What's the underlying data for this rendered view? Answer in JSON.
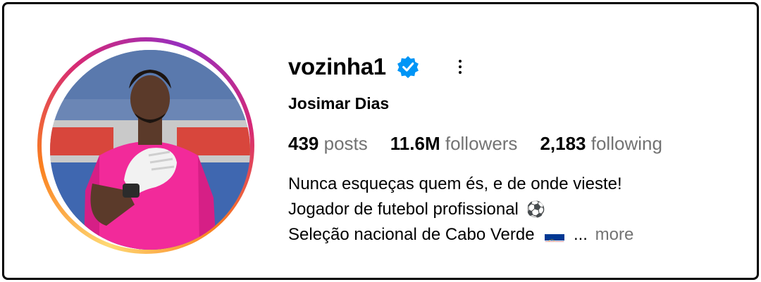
{
  "profile": {
    "username": "vozinha1",
    "verified": true,
    "full_name": "Josimar Dias"
  },
  "stats": [
    {
      "value": "439",
      "label": "posts"
    },
    {
      "value": "11.6M",
      "label": "followers"
    },
    {
      "value": "2,183",
      "label": "following"
    }
  ],
  "bio": {
    "line1": "Nunca esqueças quem és, e de onde vieste!",
    "line2": "Jogador de futebol profissional",
    "line2_emoji": "⚽",
    "line3": "Seleção nacional de Cabo Verde",
    "ellipsis": "...",
    "more_label": "more"
  },
  "colors": {
    "verified_blue": "#0095f6",
    "secondary_text": "#737373",
    "jersey_pink": "#f22a9a"
  },
  "icons": {
    "verified": "verified-badge-icon",
    "options": "more-options-icon",
    "flag": "cape-verde-flag-icon"
  }
}
